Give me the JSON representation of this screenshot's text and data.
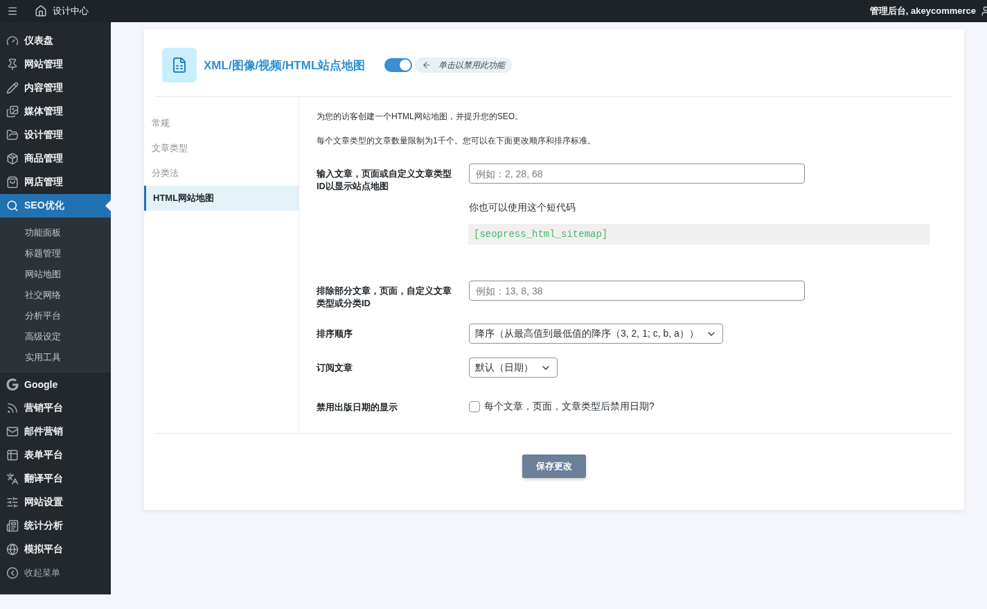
{
  "topbar": {
    "site_title": "设计中心",
    "account": "管理后台, akeycommerce"
  },
  "menu": [
    {
      "label": "仪表盘",
      "selected": false
    },
    {
      "label": "网站管理",
      "selected": false
    },
    {
      "label": "内容管理",
      "selected": false
    },
    {
      "label": "媒体管理",
      "selected": false
    },
    {
      "label": "设计管理",
      "selected": false
    },
    {
      "label": "商品管理",
      "selected": false
    },
    {
      "label": "网店管理",
      "selected": false
    },
    {
      "label": "SEO优化",
      "selected": true,
      "children": [
        {
          "label": "功能面板",
          "selected": false
        },
        {
          "label": "标题管理",
          "selected": false
        },
        {
          "label": "网站地图",
          "selected": false
        },
        {
          "label": "社交网络",
          "selected": false
        },
        {
          "label": "分析平台",
          "selected": false
        },
        {
          "label": "高级设定",
          "selected": false
        },
        {
          "label": "实用工具",
          "selected": false
        }
      ]
    },
    {
      "label": "Google",
      "selected": false
    },
    {
      "label": "营销平台",
      "selected": false
    },
    {
      "label": "邮件营销",
      "selected": false
    },
    {
      "label": "表单平台",
      "selected": false
    },
    {
      "label": "翻译平台",
      "selected": false
    },
    {
      "label": "网站设置",
      "selected": false
    },
    {
      "label": "统计分析",
      "selected": false
    },
    {
      "label": "模拟平台",
      "selected": false
    }
  ],
  "collapse_menu": "收起菜单",
  "header": {
    "title": "XML/图像/视频/HTML站点地图",
    "enabled": true,
    "hint": "单击以禁用此功能"
  },
  "tabs": [
    {
      "label": "常规",
      "selected": false
    },
    {
      "label": "文章类型",
      "selected": false
    },
    {
      "label": "分类法",
      "selected": false
    },
    {
      "label": "HTML网站地图",
      "selected": true
    }
  ],
  "intro": [
    "为您的访客创建一个HTML网站地图，并提升您的SEO。",
    "每个文章类型的文章数量限制为1千个。您可以在下面更改顺序和排序标准。"
  ],
  "fields": [
    {
      "kind": "input",
      "label": "输入文章，页面或自定义文章类型ID以显示站点地图",
      "placeholder": "例如：2, 28, 68",
      "shortcode_note": "你也可以使用这个短代码",
      "shortcode": "[seopress_html_sitemap]"
    },
    {
      "kind": "input",
      "label": "排除部分文章，页面，自定义文章类型或分类ID",
      "placeholder": "例如：13, 8, 38"
    },
    {
      "kind": "select",
      "label": "排序顺序",
      "value": "降序（从最高值到最低值的降序（3, 2, 1; c, b, a））"
    },
    {
      "kind": "select",
      "label": "订阅文章",
      "value": "默认（日期）"
    },
    {
      "kind": "checkbox",
      "label": "禁用出版日期的显示",
      "checked": false,
      "text": "每个文章，页面，文章类型后禁用日期?"
    }
  ],
  "save_button": "保存更改"
}
